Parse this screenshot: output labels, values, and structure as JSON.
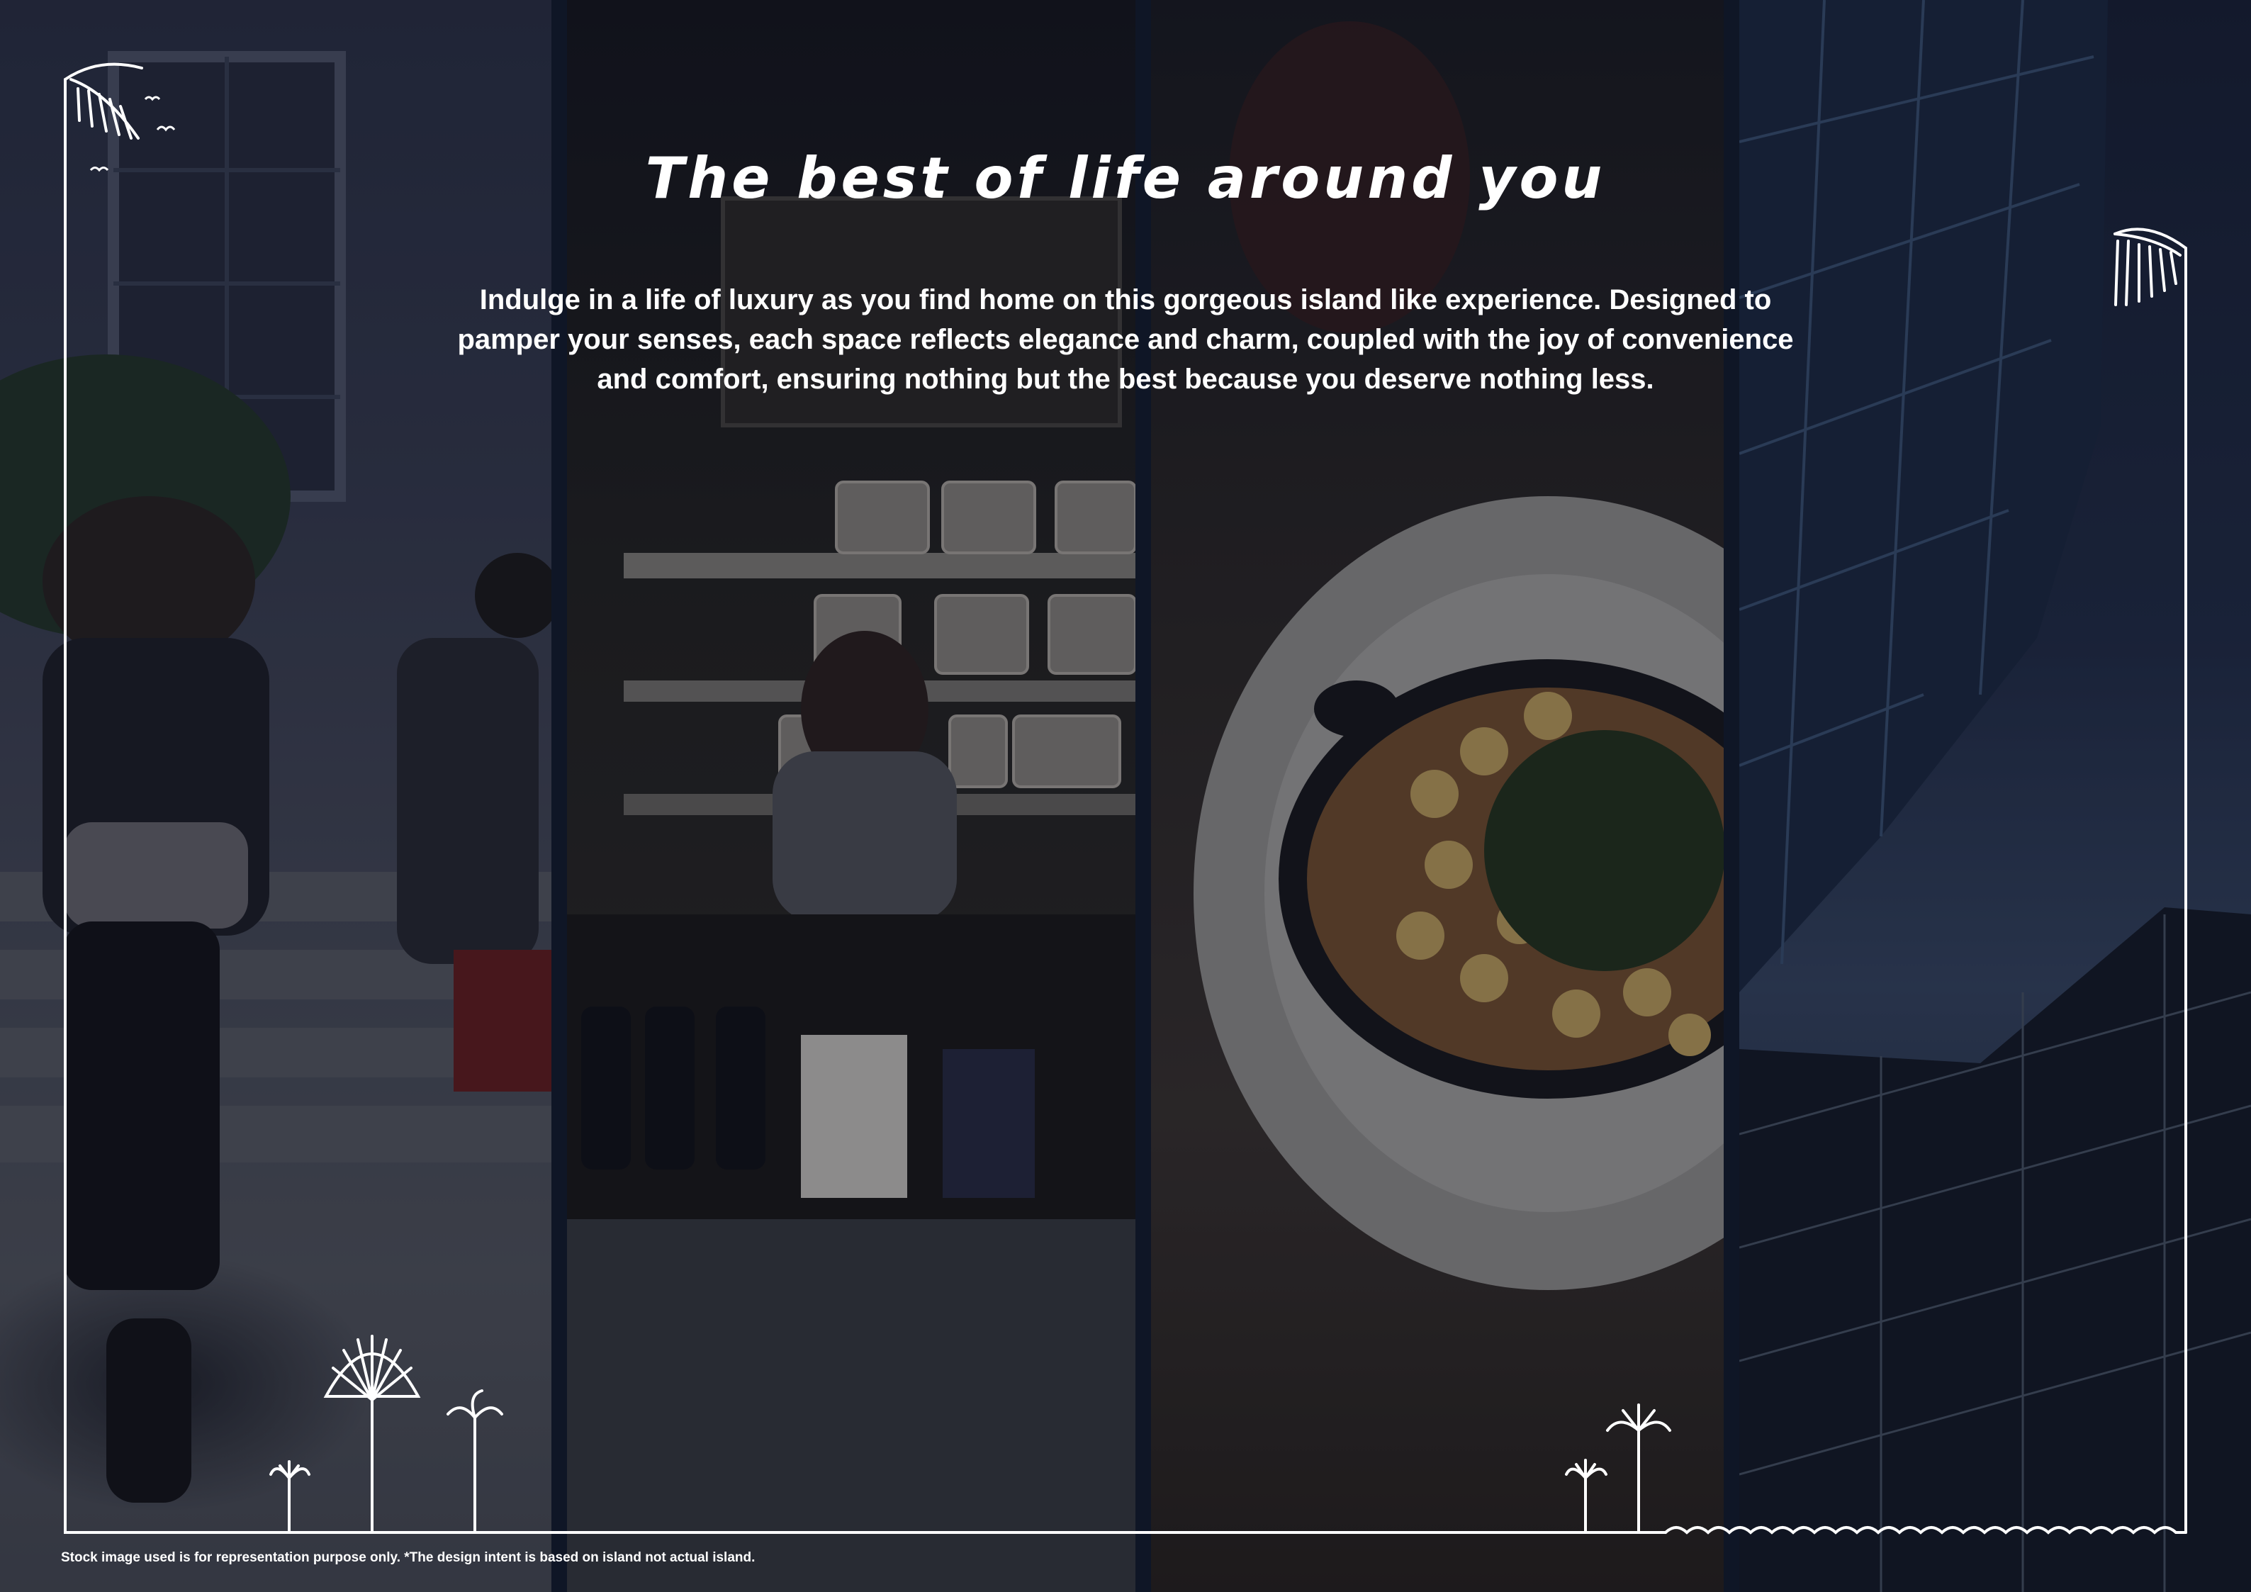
{
  "title": "The best of life around you",
  "intro": "Indulge in a life of luxury as you find home on this gorgeous island like experience. Designed to pamper your senses, each space reflects elegance and charm, coupled with the joy of convenience and comfort, ensuring nothing but the best because you deserve nothing less.",
  "disclaimer": "Stock image used is for representation purpose only.  *The design intent is based on island not actual island.",
  "panels": [
    {
      "subject": "students-walking-to-school-photo"
    },
    {
      "subject": "cafe-counter-photo"
    },
    {
      "subject": "gourmet-dish-photo"
    },
    {
      "subject": "glass-skyscrapers-photo"
    }
  ],
  "colors": {
    "text": "#ffffff",
    "frame": "#ffffff",
    "overlay": "#0a1020"
  }
}
